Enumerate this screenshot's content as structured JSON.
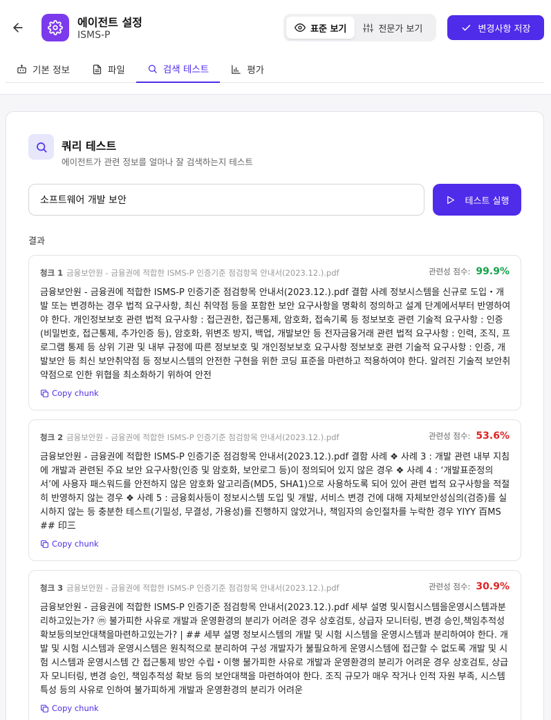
{
  "header": {
    "title": "에이전트 설정",
    "subtitle": "ISMS-P",
    "view_standard": "표준 보기",
    "view_expert": "전문가 보기",
    "save_label": "변경사항 저장"
  },
  "tabs": [
    {
      "label": "기본 정보",
      "icon": "bot-icon"
    },
    {
      "label": "파일",
      "icon": "file-icon"
    },
    {
      "label": "검색 테스트",
      "icon": "search-icon",
      "active": true
    },
    {
      "label": "평가",
      "icon": "bar-chart-icon"
    }
  ],
  "query": {
    "title": "쿼리 테스트",
    "subtitle": "에이전트가 관련 정보를 얼마나 잘 검색하는지 테스트",
    "input_value": "소프트웨어 개발 보안",
    "run_label": "테스트 실행",
    "results_label": "결과"
  },
  "colors": {
    "accent": "#4f2bea",
    "score_high": "#16a34a",
    "score_low": "#dc2626"
  },
  "chunks": [
    {
      "index": "청크 1",
      "source": "금융보안원 - 금융권에 적합한 ISMS-P 인증기준 점검항목 안내서(2023.12.).pdf",
      "score_label": "관련성 점수:",
      "score": "99.9%",
      "text": "금융보안원 - 금융권에 적합한 ISMS-P 인증기준 점검항목 안내서(2023.12.).pdf 결함 사례 정보시스템을 신규로 도입・개발 또는 변경하는 경우 법적 요구사항, 최신 취약점 등을 포함한 보안 요구사항을 명확히 정의하고 설계 단계에서부터 반영하여야 한다. 개인정보보호 관련 법적 요구사항 : 접근권한, 접근통제, 암호화, 접속기록 등 정보보호 관련 기술적 요구사항 : 인증(비밀번호, 접근통제, 추가인증 등), 암호화, 위변조 방지, 백업, 개발보안 등 전자금융거래 관련 법적 요구사항 : 인력, 조직, 프로그램 통제 등 상위 기관 및 내부 규정에 따른 정보보호 및 개인정보보호 요구사항 정보보호 관련 기술적 요구사항 : 인증, 개발보안 등 최신 보안취약점 등 정보시스템의 안전한 구현을 위한 코딩 표준을 마련하고 적용하여야 한다. 알려진 기술적 보안취약점으로 인한 위협을 최소화하기 위하여 안전",
      "copy_label": "Copy chunk"
    },
    {
      "index": "청크 2",
      "source": "금융보안원 - 금융권에 적합한 ISMS-P 인증기준 점검항목 안내서(2023.12.).pdf",
      "score_label": "관련성 점수:",
      "score": "53.6%",
      "text": "금융보안원 - 금융권에 적합한 ISMS-P 인증기준 점검항목 안내서(2023.12.).pdf 결함 사례 ❖ 사례 3 : 개발 관련 내부 지침에 개발과 관련된 주요 보안 요구사항(인증 및 암호화, 보안로그 등)이 정의되어 있지 않은 경우 ❖ 사례 4 : ‘개발표준정의서’에 사용자 패스워드를 안전하지 않은 암호화 알고리즘(MD5, SHA1)으로 사용하도록 되어 있어 관련 법적 요구사항을 적절히 반영하지 않는 경우 ❖ 사례 5 : 금융회사등이 정보시스템 도입 및 개발, 서비스 변경 건에 대해 자체보안성심의(검증)를 실시하지 않는 등 충분한 테스트(기밀성, 무결성, 가용성)를 진행하지 않았거나, 책임자의 승인절차를 누락한 경우 YIYY 百MS ## 印三",
      "copy_label": "Copy chunk"
    },
    {
      "index": "청크 3",
      "source": "금융보안원 - 금융권에 적합한 ISMS-P 인증기준 점검항목 안내서(2023.12.).pdf",
      "score_label": "관련성 점수:",
      "score": "30.9%",
      "text": "금융보안원 - 금융권에 적합한 ISMS-P 인증기준 점검항목 안내서(2023.12.).pdf 세부 설명 및시험시스템을운영시스템과분리하고있는가? ⓜ 불가피한 사유로 개발과 운영환경의 분리가 어려운 경우 상호검토, 상급자 모니터링, 변경 승인,책임추적성 확보등의보안대책을마련하고있는가? | ## 세부 설명 정보시스템의 개발 및 시험 시스템을 운영시스템과 분리하여야 한다. 개발 및 시험 시스템과 운영시스템은 원칙적으로 분리하여 구성 개발자가 불필요하게 운영시스템에 접근할 수 없도록 개발 및 시험 시스템과 운영시스템 간 접근통제 방안 수립・이행 불가피한 사유로 개발과 운영환경의 분리가 어려운 경우 상호검토, 상급자 모니터링, 변경 승인, 책임추적성 확보 등의 보안대책을 마련하여야 한다. 조직 규모가 매우 작거나 인적 자원 부족, 시스템 특성 등의 사유로 인하여 불가피하게 개발과 운영환경의 분리가 어려운",
      "copy_label": "Copy chunk"
    }
  ]
}
